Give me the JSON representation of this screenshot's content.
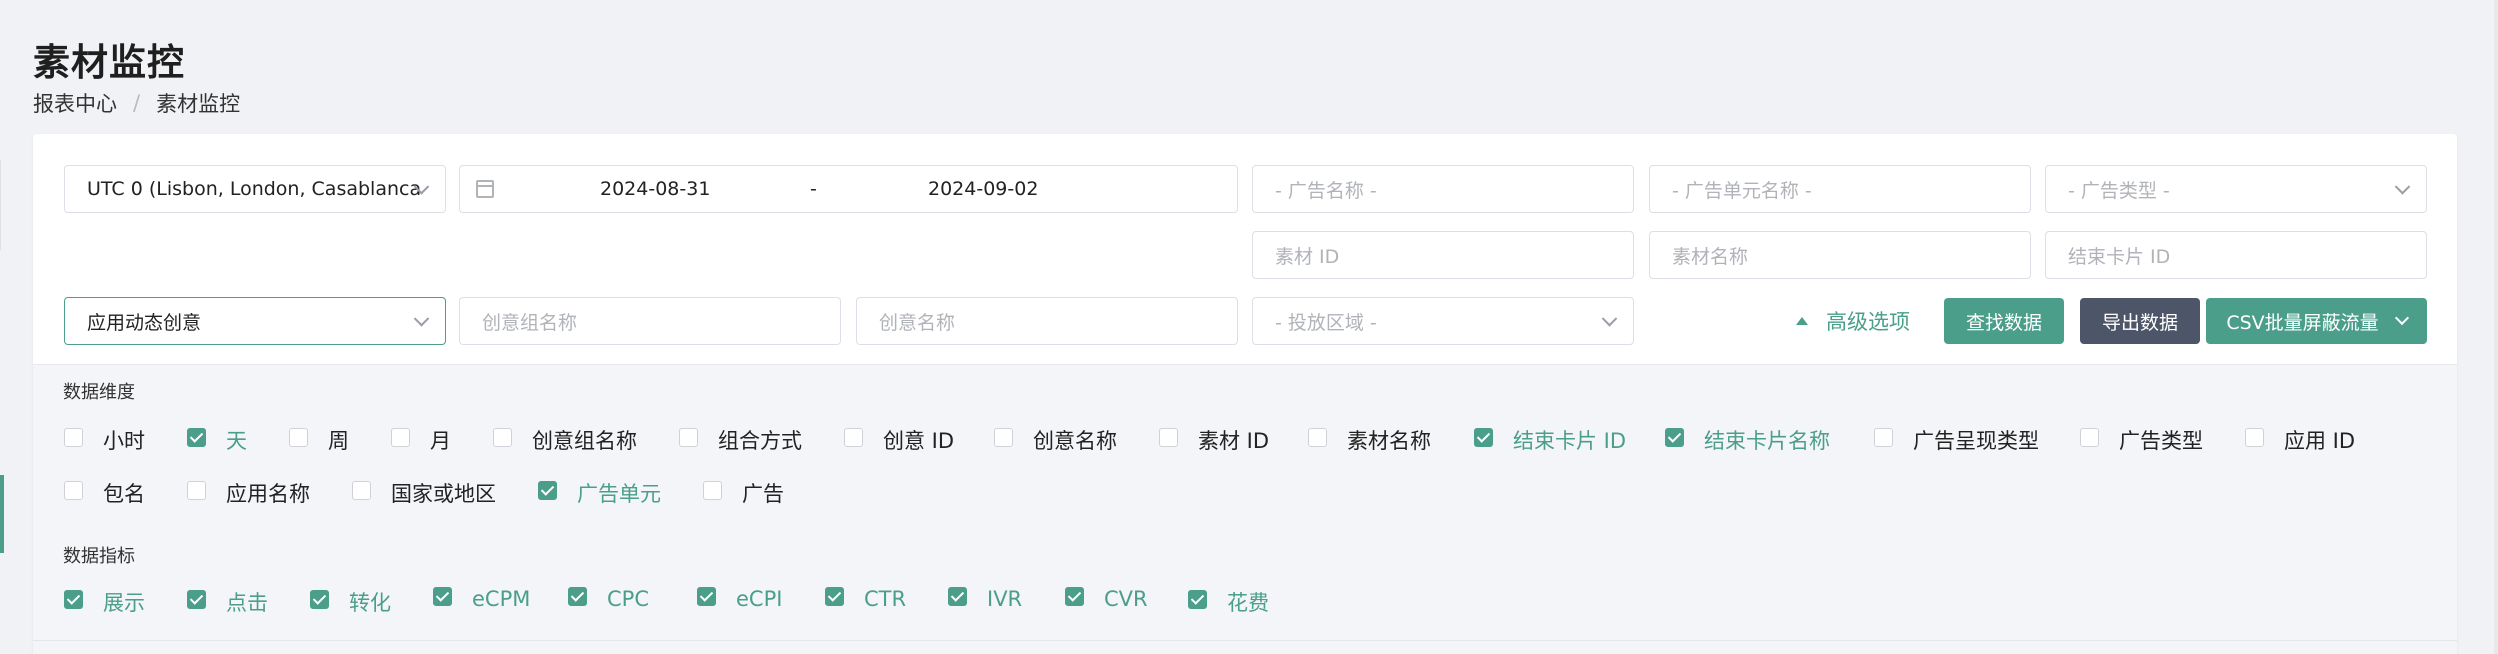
{
  "page": {
    "title": "素材监控"
  },
  "breadcrumb": {
    "items": [
      "报表中心",
      "素材监控"
    ],
    "separator": "/"
  },
  "filters": {
    "timezone": "UTC 0 (Lisbon, London, Casablanca",
    "date_start": "2024-08-31",
    "date_separator": "-",
    "date_end": "2024-09-02",
    "ad_name_placeholder": "- 广告名称 -",
    "ad_unit_name_placeholder": "- 广告单元名称 -",
    "ad_type_placeholder": "- 广告类型 -",
    "material_id_placeholder": "素材 ID",
    "material_name_placeholder": "素材名称",
    "end_card_id_placeholder": "结束卡片 ID",
    "creative_type": "应用动态创意",
    "creative_group_placeholder": "创意组名称",
    "creative_name_placeholder": "创意名称",
    "region_placeholder": "- 投放区域 -"
  },
  "actions": {
    "advanced": "高级选项",
    "search": "查找数据",
    "export": "导出数据",
    "csv_block": "CSV批量屏蔽流量"
  },
  "dimensions": {
    "title": "数据维度",
    "items": [
      {
        "label": "小时",
        "checked": false
      },
      {
        "label": "天",
        "checked": true
      },
      {
        "label": "周",
        "checked": false
      },
      {
        "label": "月",
        "checked": false
      },
      {
        "label": "创意组名称",
        "checked": false
      },
      {
        "label": "组合方式",
        "checked": false
      },
      {
        "label": "创意 ID",
        "checked": false
      },
      {
        "label": "创意名称",
        "checked": false
      },
      {
        "label": "素材 ID",
        "checked": false
      },
      {
        "label": "素材名称",
        "checked": false
      },
      {
        "label": "结束卡片 ID",
        "checked": true
      },
      {
        "label": "结束卡片名称",
        "checked": true
      },
      {
        "label": "广告呈现类型",
        "checked": false
      },
      {
        "label": "广告类型",
        "checked": false
      },
      {
        "label": "应用 ID",
        "checked": false
      },
      {
        "label": "包名",
        "checked": false
      },
      {
        "label": "应用名称",
        "checked": false
      },
      {
        "label": "国家或地区",
        "checked": false
      },
      {
        "label": "广告单元",
        "checked": true
      },
      {
        "label": "广告",
        "checked": false
      }
    ]
  },
  "metrics": {
    "title": "数据指标",
    "items": [
      {
        "label": "展示",
        "checked": true
      },
      {
        "label": "点击",
        "checked": true
      },
      {
        "label": "转化",
        "checked": true
      },
      {
        "label": "eCPM",
        "checked": true
      },
      {
        "label": "CPC",
        "checked": true
      },
      {
        "label": "eCPI",
        "checked": true
      },
      {
        "label": "CTR",
        "checked": true
      },
      {
        "label": "IVR",
        "checked": true
      },
      {
        "label": "CVR",
        "checked": true
      },
      {
        "label": "花费",
        "checked": true
      }
    ]
  },
  "colors": {
    "accent": "#4a9e8a",
    "dark_button": "#4d5669",
    "panel_bg": "#f4f5f9"
  }
}
